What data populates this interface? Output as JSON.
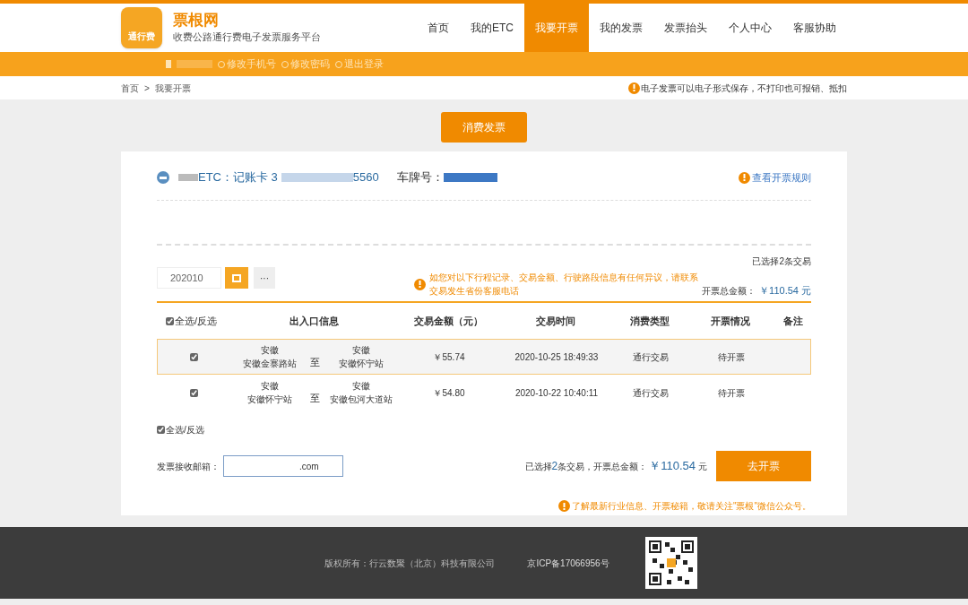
{
  "brand": {
    "logo": "通行费",
    "name": "票根网",
    "tagline": "收费公路通行费电子发票服务平台"
  },
  "nav": [
    {
      "label": "首页",
      "selected": false
    },
    {
      "label": "我的ETC",
      "selected": false
    },
    {
      "label": "我要开票",
      "selected": true
    },
    {
      "label": "我的发票",
      "selected": false
    },
    {
      "label": "发票抬头",
      "selected": false
    },
    {
      "label": "个人中心",
      "selected": false
    },
    {
      "label": "客服协助",
      "selected": false
    }
  ],
  "user_links": [
    "修改手机号",
    "修改密码",
    "退出登录"
  ],
  "breadcrumb": [
    "首页",
    ">",
    "我要开票"
  ],
  "notice": "电子发票可以电子形式保存，不打印也可报销、抵扣",
  "invoice_type": "消费发票",
  "card": {
    "prefix": "ETC：",
    "type": "记账卡 3",
    "number_end": "5560",
    "plate_label": "车牌号：",
    "rules_link": "查看开票规则"
  },
  "month": {
    "value": "202010",
    "more": "···"
  },
  "summary_top": {
    "selected": "已选择2条交易",
    "total_label": "开票总金额：",
    "total": "￥110.54 元"
  },
  "warning": "如您对以下行程记录、交易金额、行驶路段信息有任何异议，请联系交易发生省份客服电话",
  "table": {
    "select_all": "全选/反选",
    "select_all_checked": true,
    "columns": [
      "出入口信息",
      "交易金额（元）",
      "交易时间",
      "消费类型",
      "开票情况",
      "备注"
    ],
    "rows": [
      {
        "checked": true,
        "hovered": true,
        "from_province": "安徽",
        "from_station": "安徽金寨路站",
        "to": "至",
        "to_province": "安徽",
        "to_station": "安徽怀宁站",
        "amount": "￥55.74",
        "time": "2020-10-25 18:49:33",
        "type": "通行交易",
        "status": "待开票"
      },
      {
        "checked": true,
        "hovered": false,
        "from_province": "安徽",
        "from_station": "安徽怀宁站",
        "to": "至",
        "to_province": "安徽",
        "to_station": "安徽包河大道站",
        "amount": "￥54.80",
        "time": "2020-10-22 10:40:11",
        "type": "通行交易",
        "status": "待开票"
      }
    ]
  },
  "select_all_bottom": {
    "label": "全选/反选",
    "checked": true
  },
  "email": {
    "label": "发票接收邮箱：",
    "value": ".com"
  },
  "summary_bottom": {
    "text_a": "已选择",
    "count": "2",
    "text_b": "条交易，开票总金额：",
    "total": "￥110.54",
    "unit": "元"
  },
  "submit": "去开票",
  "follow": "了解最新行业信息、开票秘籍，敬请关注\"票根\"微信公众号。",
  "footer": {
    "copyright": "版权所有：行云数聚（北京）科技有限公司",
    "icp": "京ICP备17066956号"
  }
}
